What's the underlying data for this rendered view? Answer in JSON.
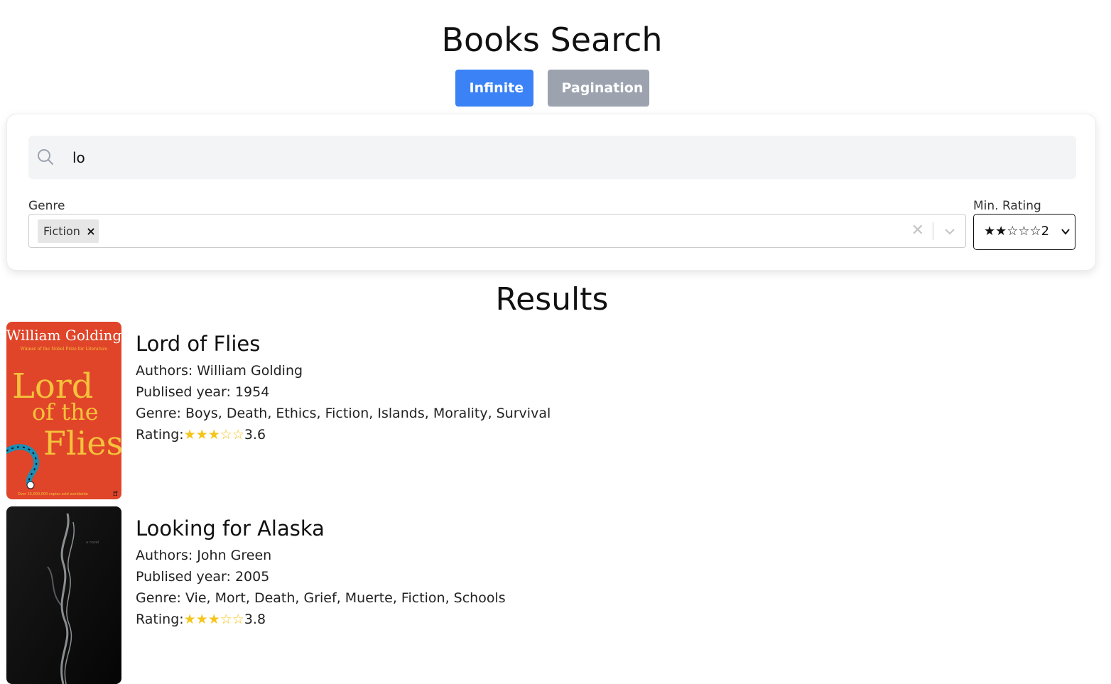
{
  "header": {
    "title": "Books Search",
    "modes": [
      "Infinite",
      "Pagination"
    ]
  },
  "search": {
    "value": "lo",
    "icon": "search-icon"
  },
  "filters": {
    "genre_label": "Genre",
    "genre_selected": [
      "Fiction"
    ],
    "rating_label": "Min. Rating",
    "rating_value": "★★☆☆☆2"
  },
  "results": {
    "title": "Results",
    "books": [
      {
        "title": "Lord of Flies",
        "authors": "Authors: William Golding",
        "year": "Publised year: 1954",
        "genre": "Genre: Boys, Death, Ethics, Fiction, Islands, Morality, Survival",
        "rating_label": "Rating:",
        "rating_stars": "★★★☆☆",
        "rating_value": "3.6",
        "cover_author": "William Golding",
        "cover_subtitle": "Winner of the Nobel Prize for Literature",
        "cover_title_lines": [
          "Lord",
          "of the",
          "Flies"
        ],
        "cover_footer": "Over 15,000,000 copies sold worldwide",
        "cover_publisher": "ff"
      },
      {
        "title": "Looking for Alaska",
        "authors": "Authors: John Green",
        "year": "Publised year: 2005",
        "genre": "Genre: Vie, Mort, Death, Grief, Muerte, Fiction, Schools",
        "rating_label": "Rating:",
        "rating_stars": "★★★☆☆",
        "rating_value": "3.8",
        "cover_caption": "a novel"
      }
    ]
  },
  "colors": {
    "primary": "#3b82f6",
    "inactive": "#9ca3af",
    "star": "#f5c518",
    "cover1_bg": "#e0452a",
    "cover1_text": "#f5c33b"
  }
}
